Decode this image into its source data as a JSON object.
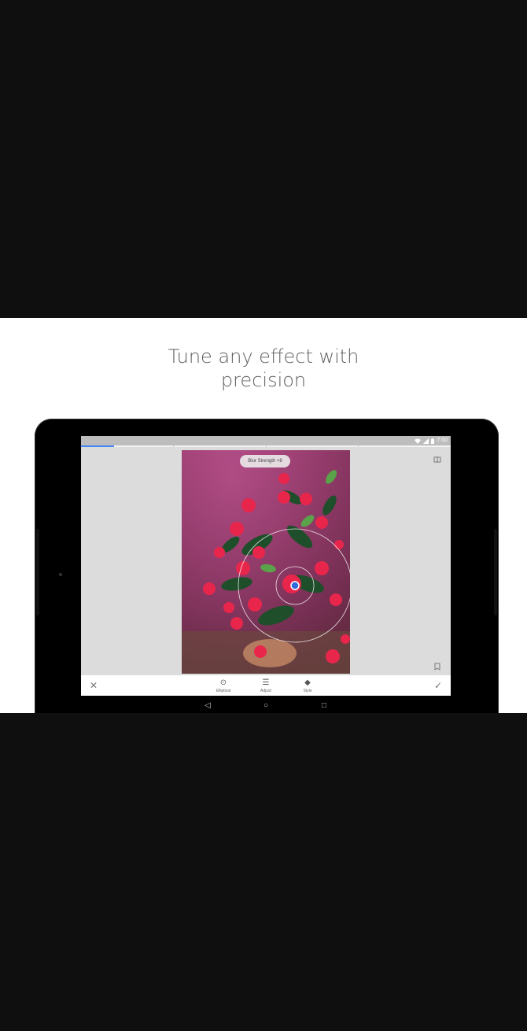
{
  "promo": {
    "headline_line1": "Tune any effect with",
    "headline_line2": "precision"
  },
  "tablet_screen": {
    "status": {
      "time": "7:00",
      "icons": [
        "wifi-icon",
        "signal-icon",
        "battery-icon"
      ]
    },
    "progress": {
      "fraction": 0.09
    },
    "overlay": {
      "blur_label": "Blur Strength +8"
    },
    "toolbar": {
      "tools": [
        {
          "label": "Elliptical",
          "icon": "elliptical-icon"
        },
        {
          "label": "Adjust",
          "icon": "sliders-icon"
        },
        {
          "label": "Style",
          "icon": "style-icon"
        }
      ],
      "close_icon": "close-icon",
      "apply_icon": "check-icon"
    },
    "nav": [
      "back-icon",
      "home-icon",
      "recents-icon"
    ]
  },
  "colors": {
    "accent": "#4285f4",
    "background": "#0f0f0f",
    "panel": "#ffffff"
  }
}
